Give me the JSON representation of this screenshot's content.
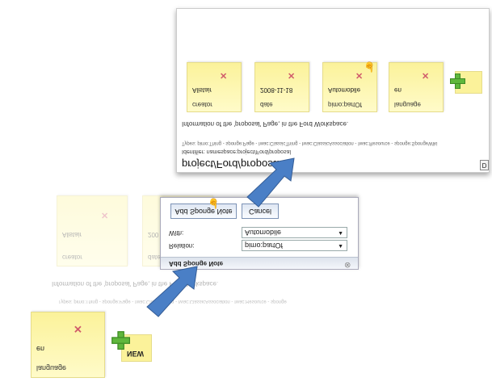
{
  "top_panel": {
    "title": "project/Ford/proposal",
    "corner_label": "D",
    "identifier_line": "Identifier: namespace:project/Ford/proposal",
    "types_line": "Types: pimo:Thing - sponge:Page - Iwac:ClassicThing - Iwac:ClassicAssociation - Iwac:Resource - sponge:SpongeWiki",
    "info": "Information of the 'proposal' Page, in the Ford Workspace.",
    "notes": [
      {
        "key": "creator",
        "value": "Alistair"
      },
      {
        "key": "date",
        "value": "2008-11-18"
      },
      {
        "key": "pimo:partOf",
        "value": "Automobile"
      },
      {
        "key": "language",
        "value": "en"
      }
    ]
  },
  "middle_panel": {
    "info": "Information of the 'proposal' Page, in the Ford Workspace.",
    "types_line": "Types: pimo:Thing - sponge:Page - Iwac:ClassicThing - Iwac:ClassicAssociation - Iwac:Resource - sponge",
    "notes": [
      {
        "key": "creator",
        "value": "Alistair"
      },
      {
        "key": "date",
        "value": "200"
      }
    ]
  },
  "dialog": {
    "title": "Add Sponge Note",
    "relation_label": "Relation:",
    "relation_value": "pimo:partOf",
    "with_label": "With:",
    "with_value": "Automobile",
    "add_button": "Add Sponge Note",
    "cancel_button": "Cancel",
    "close_glyph": "⊗"
  },
  "bottom_note": {
    "key": "language",
    "value": "en",
    "new_label": "NEW"
  },
  "colors": {
    "note_fill": "#fbf29a",
    "arrow": "#4a7fc6",
    "add_plus": "#5fb73c",
    "delete_x": "#d05a6a"
  }
}
